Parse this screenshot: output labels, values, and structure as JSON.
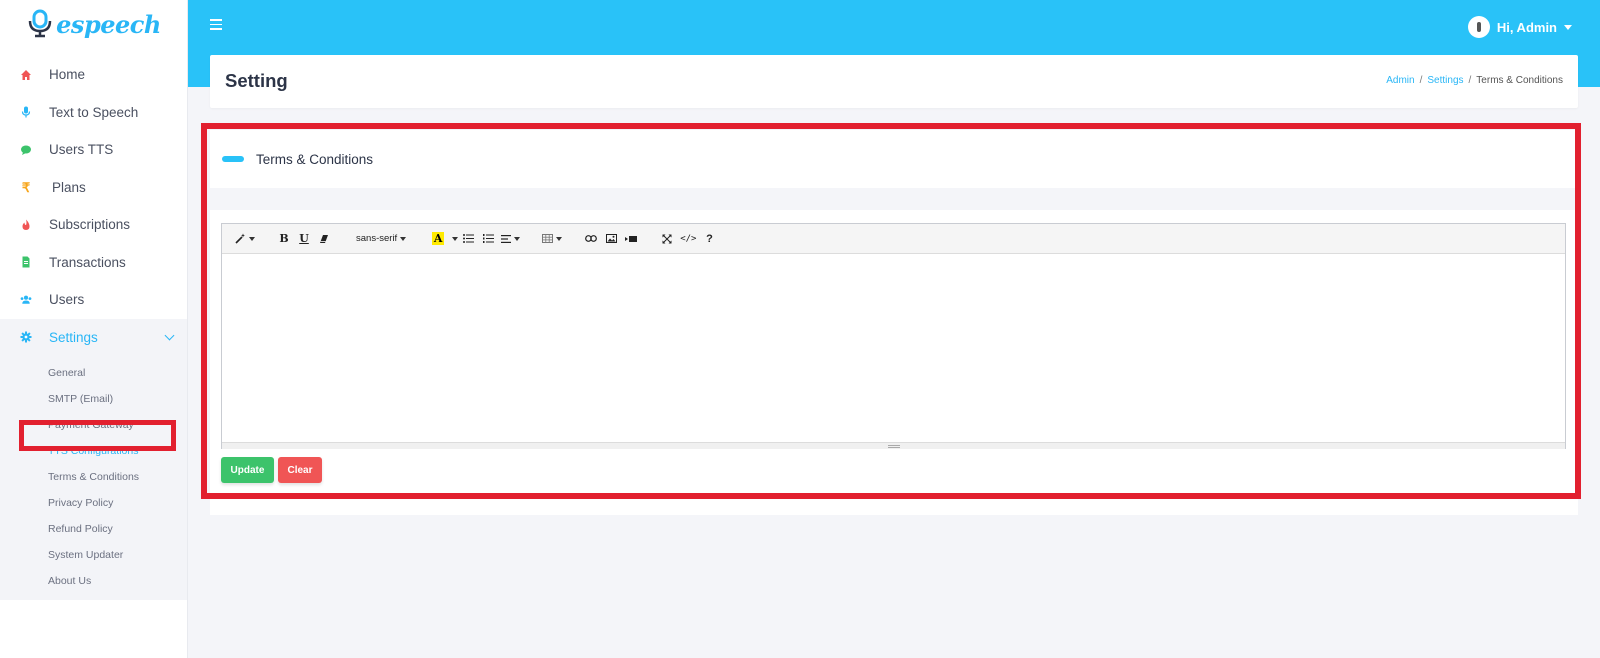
{
  "brand": {
    "name": "espeech",
    "color": "#29b6f6"
  },
  "sidebar": {
    "items": [
      {
        "label": "Home",
        "icon": "home-icon",
        "color": "#f05555"
      },
      {
        "label": "Text to Speech",
        "icon": "microphone-icon",
        "color": "#29b6f6"
      },
      {
        "label": "Users TTS",
        "icon": "comment-icon",
        "color": "#3cc36b"
      },
      {
        "label": "Plans",
        "icon": "rupee-icon",
        "color": "#f7a61b"
      },
      {
        "label": "Subscriptions",
        "icon": "fire-icon",
        "color": "#f05555"
      },
      {
        "label": "Transactions",
        "icon": "file-invoice-icon",
        "color": "#3cc36b"
      },
      {
        "label": "Users",
        "icon": "users-icon",
        "color": "#29b6f6"
      },
      {
        "label": "Settings",
        "icon": "gear-icon",
        "color": "#29b6f6"
      }
    ],
    "settings_submenu": [
      "General",
      "SMTP (Email)",
      "Payment Gateway",
      "TTS Configurations",
      "Terms & Conditions",
      "Privacy Policy",
      "Refund Policy",
      "System Updater",
      "About Us"
    ]
  },
  "topbar": {
    "user_label": "Hi, Admin",
    "color": "#29c2f8"
  },
  "header": {
    "title": "Setting",
    "breadcrumb": [
      "Admin",
      "Settings",
      "Terms & Conditions"
    ]
  },
  "card": {
    "title": "Terms & Conditions"
  },
  "editor": {
    "font_family_label": "sans-serif",
    "highlight_label": "A",
    "bold_label": "B",
    "underline_label": "U",
    "code_label": "</>",
    "help_label": "?",
    "content": ""
  },
  "buttons": {
    "update": "Update",
    "clear": "Clear"
  },
  "annotations": {
    "highlight_color": "#e2202f"
  }
}
